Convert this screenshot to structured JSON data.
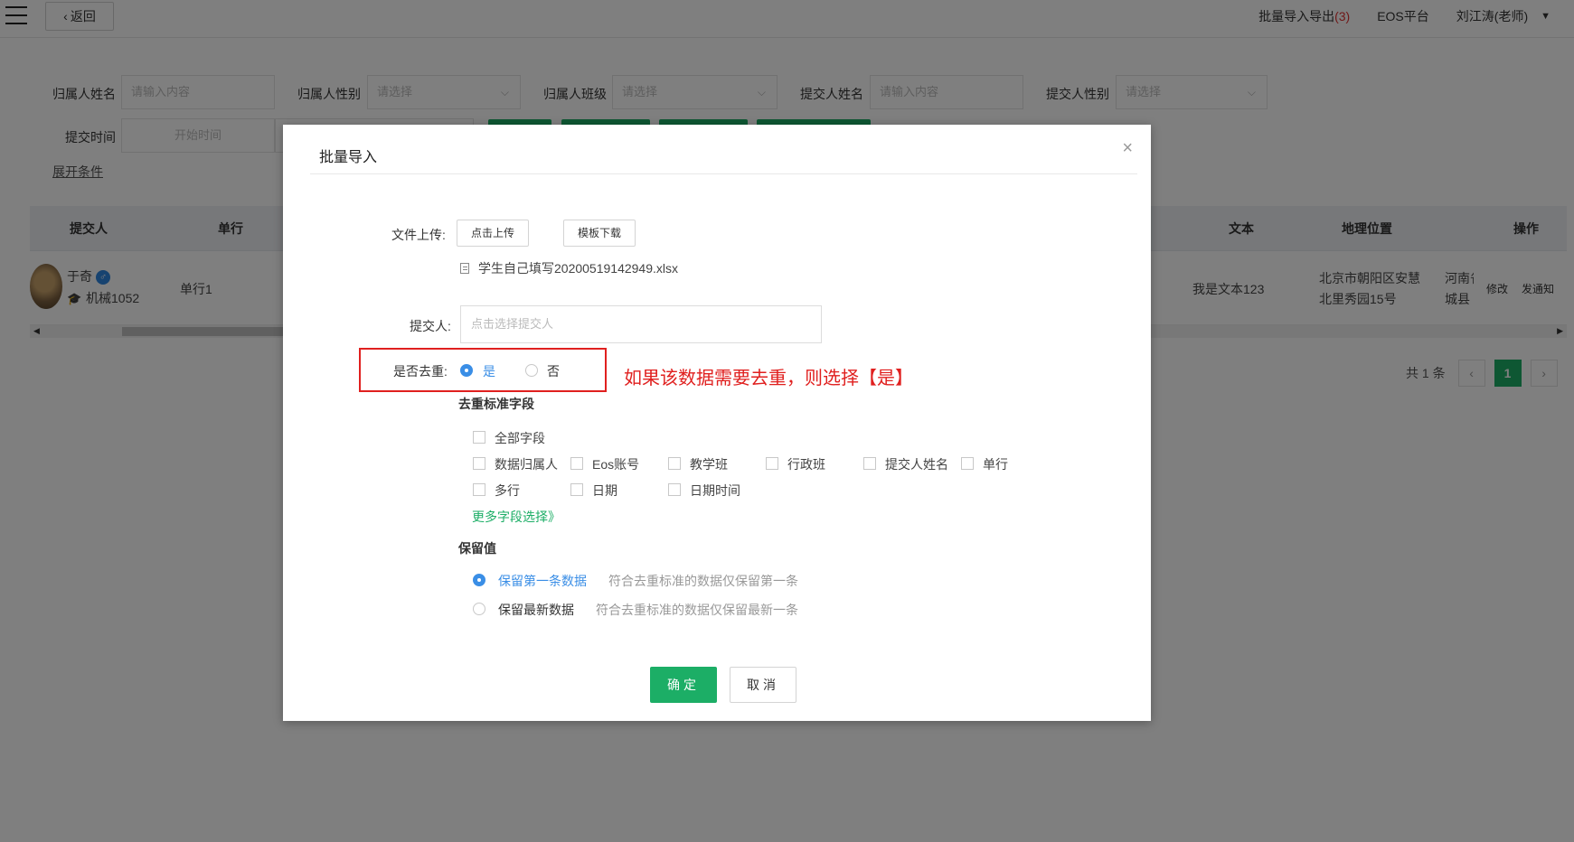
{
  "topbar": {
    "menu_icon": "hamburger-menu-icon",
    "back_label": "返回",
    "batch_label": "批量导入导出",
    "batch_count": "(3)",
    "eos_label": "EOS平台",
    "user_label": "刘江涛(老师)"
  },
  "filters": {
    "owner_name_label": "归属人姓名",
    "owner_name_placeholder": "请输入内容",
    "owner_gender_label": "归属人性别",
    "owner_gender_placeholder": "请选择",
    "owner_class_label": "归属人班级",
    "owner_class_placeholder": "请选择",
    "submitter_name_label": "提交人姓名",
    "submitter_name_placeholder": "请输入内容",
    "submitter_gender_label": "提交人性别",
    "submitter_gender_placeholder": "请选择",
    "submit_time_label": "提交时间",
    "start_time_placeholder": "开始时间",
    "expand_label": "展开条件"
  },
  "table": {
    "headers": {
      "submitter": "提交人",
      "single_line": "单行",
      "text": "文本",
      "location": "地理位置",
      "actions": "操作"
    },
    "row": {
      "name": "于奇",
      "gender_icon": "male-icon",
      "dept": "机械1052",
      "single_line": "单行1",
      "text": "我是文本123",
      "location_line1": "北京市朝阳区安慧",
      "location_line2": "北里秀园15号",
      "extra_line1": "河南省",
      "extra_line2": "城县",
      "edit": "修改",
      "notify": "发通知"
    }
  },
  "pagination": {
    "total": "共 1 条",
    "current_page": "1"
  },
  "modal": {
    "title": "批量导入",
    "file_upload_label": "文件上传:",
    "upload_btn": "点击上传",
    "template_btn": "模板下载",
    "file_name": "学生自己填写20200519142949.xlsx",
    "submitter_label": "提交人:",
    "submitter_placeholder": "点击选择提交人",
    "dedup_label": "是否去重:",
    "dedup_yes": "是",
    "dedup_no": "否",
    "dedup_selected": "是",
    "annotation": "如果该数据需要去重，则选择【是】",
    "dedup_fields_title": "去重标准字段",
    "fields": {
      "all": "全部字段",
      "owner": "数据归属人",
      "eos": "Eos账号",
      "teaching_class": "教学班",
      "admin_class": "行政班",
      "submitter_name": "提交人姓名",
      "single_line": "单行",
      "multi_line": "多行",
      "date": "日期",
      "datetime": "日期时间"
    },
    "more_fields": "更多字段选择》",
    "keep_title": "保留值",
    "keep_first": "保留第一条数据",
    "keep_first_desc": "符合去重标准的数据仅保留第一条",
    "keep_latest": "保留最新数据",
    "keep_latest_desc": "符合去重标准的数据仅保留最新一条",
    "keep_selected": "保留第一条数据",
    "ok": "确定",
    "cancel": "取消"
  },
  "colors": {
    "primary_green": "#1cae66",
    "radio_blue": "#3a8ee6",
    "annotation_red": "#e0201f",
    "batch_count_red": "#e03131"
  }
}
